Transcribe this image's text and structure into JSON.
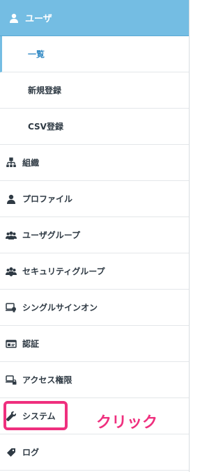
{
  "header": {
    "label": "ユーザ",
    "icon": "user-icon"
  },
  "submenu": [
    {
      "label": "一覧",
      "active": true
    },
    {
      "label": "新規登録",
      "active": false
    },
    {
      "label": "CSV登録",
      "active": false
    }
  ],
  "items": [
    {
      "label": "組織",
      "icon": "org-chart-icon"
    },
    {
      "label": "プロファイル",
      "icon": "profile-icon"
    },
    {
      "label": "ユーザグループ",
      "icon": "user-group-icon"
    },
    {
      "label": "セキュリティグループ",
      "icon": "security-group-icon"
    },
    {
      "label": "シングルサインオン",
      "icon": "single-sign-on-icon"
    },
    {
      "label": "認証",
      "icon": "id-card-icon"
    },
    {
      "label": "アクセス権限",
      "icon": "access-lock-icon"
    },
    {
      "label": "システム",
      "icon": "wrench-icon"
    },
    {
      "label": "ログ",
      "icon": "tag-icon"
    }
  ],
  "annotation": {
    "text": "クリック",
    "color": "#ef2f7e"
  },
  "colors": {
    "header_bg": "#74bde3",
    "active_text": "#3b8fc7"
  }
}
